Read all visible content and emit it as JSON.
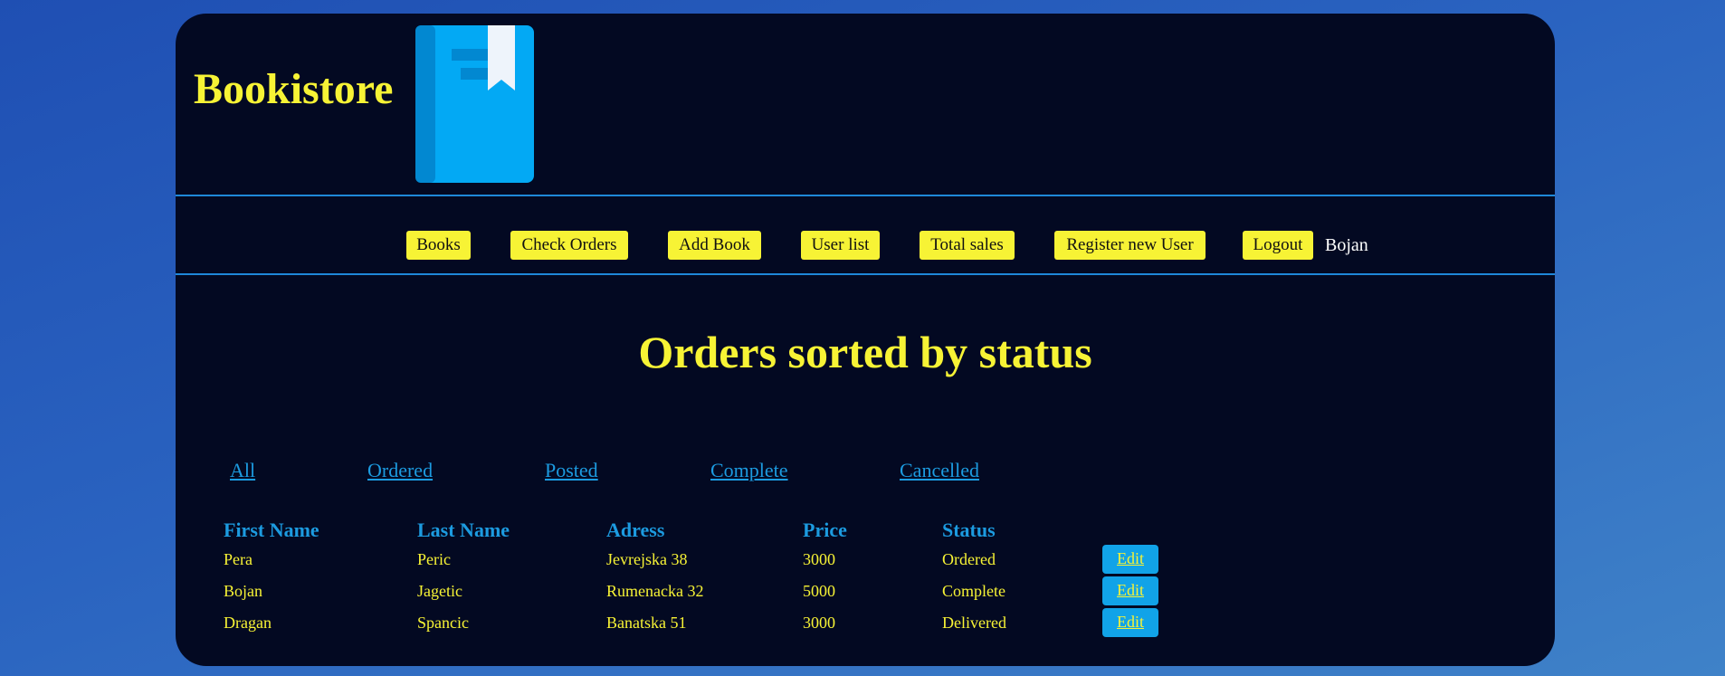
{
  "app": {
    "brand": "Bookistore",
    "logo_icon": "book-bookmark-icon"
  },
  "nav": {
    "items": [
      "Books",
      "Check Orders",
      "Add Book",
      "User list",
      "Total sales",
      "Register new User",
      "Logout"
    ],
    "username": "Bojan"
  },
  "page": {
    "title": "Orders sorted by status"
  },
  "filters": [
    "All",
    "Ordered",
    "Posted",
    "Complete",
    "Cancelled"
  ],
  "table": {
    "headers": [
      "First Name",
      "Last Name",
      "Adress",
      "Price",
      "Status"
    ],
    "rows": [
      [
        "Pera",
        "Peric",
        "Jevrejska 38",
        "3000",
        "Ordered"
      ],
      [
        "Bojan",
        "Jagetic",
        "Rumenacka 32",
        "5000",
        "Complete"
      ],
      [
        "Dragan",
        "Spancic",
        "Banatska 51",
        "3000",
        "Delivered"
      ]
    ],
    "edit_label": "Edit"
  },
  "colors": {
    "accent": "#f7f335",
    "link": "#1c9be0",
    "panel": "#030922"
  }
}
